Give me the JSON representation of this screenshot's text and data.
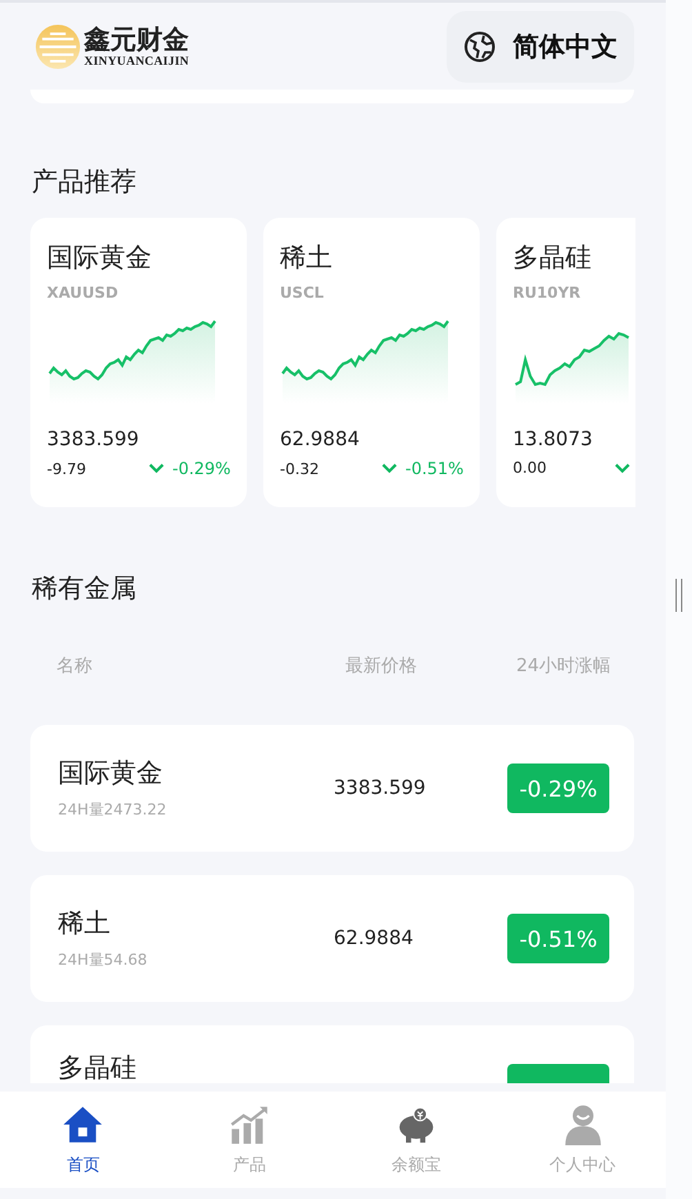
{
  "header": {
    "logo_title": "鑫元财金",
    "logo_subtitle": "XINYUANCAIJIN",
    "language": "简体中文"
  },
  "recommend": {
    "title": "产品推荐",
    "cards": [
      {
        "name": "国际黄金",
        "symbol": "XAUUSD",
        "price": "3383.599",
        "change": "-9.79",
        "percent": "-0.29%"
      },
      {
        "name": "稀土",
        "symbol": "USCL",
        "price": "62.9884",
        "change": "-0.32",
        "percent": "-0.51%"
      },
      {
        "name": "多晶硅",
        "symbol": "RU10YR",
        "price": "13.8073",
        "change": "0.00"
      }
    ]
  },
  "metals": {
    "title": "稀有金属",
    "columns": [
      "名称",
      "最新价格",
      "24小时涨幅"
    ],
    "rows": [
      {
        "name": "国际黄金",
        "volume": "24H量2473.22",
        "price": "3383.599",
        "change": "-0.29%"
      },
      {
        "name": "稀土",
        "volume": "24H量54.68",
        "price": "62.9884",
        "change": "-0.51%"
      },
      {
        "name": "多晶硅"
      }
    ]
  },
  "nav": [
    {
      "label": "首页",
      "selected": true
    },
    {
      "label": "产品",
      "selected": false
    },
    {
      "label": "余额宝",
      "selected": false
    },
    {
      "label": "个人中心",
      "selected": false
    }
  ]
}
